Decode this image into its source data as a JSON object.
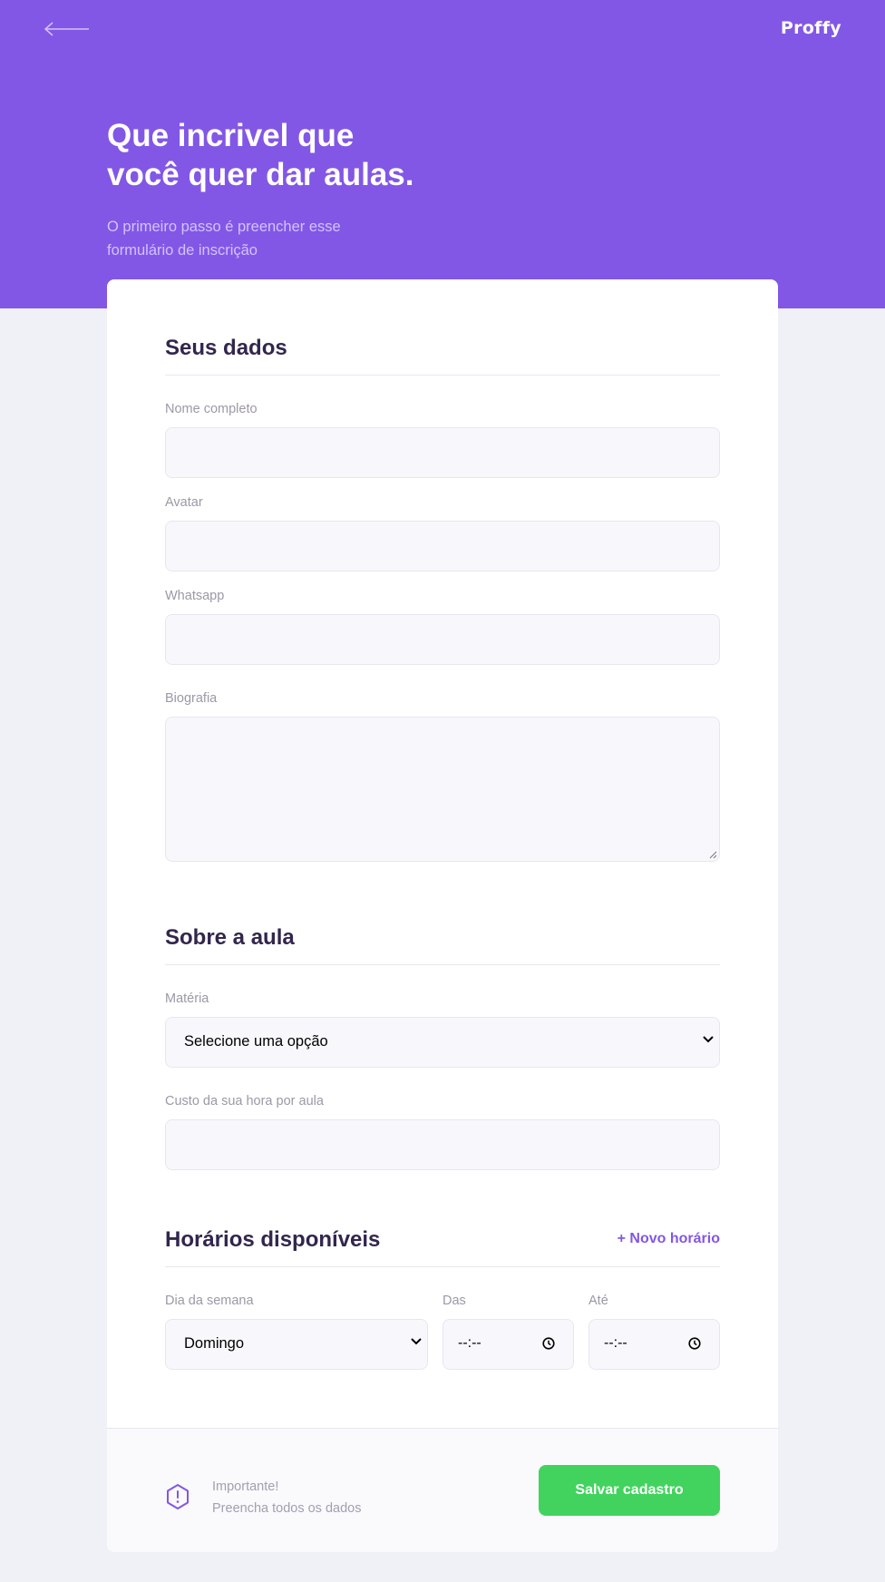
{
  "header": {
    "back_icon": "arrow-left-icon",
    "logo": "Proffy",
    "title_line1": "Que incrivel que",
    "title_line2": "você quer dar aulas.",
    "subtitle_line1": "O primeiro passo é preencher esse",
    "subtitle_line2": "formulário de inscrição"
  },
  "personal": {
    "section_title": "Seus dados",
    "name_label": "Nome completo",
    "name_value": "",
    "avatar_label": "Avatar",
    "avatar_value": "",
    "whatsapp_label": "Whatsapp",
    "whatsapp_value": "",
    "bio_label": "Biografia",
    "bio_value": ""
  },
  "class_info": {
    "section_title": "Sobre a aula",
    "subject_label": "Matéria",
    "subject_selected": "Selecione uma opção",
    "cost_label": "Custo da sua hora por aula",
    "cost_value": ""
  },
  "schedule": {
    "section_title": "Horários disponíveis",
    "new_time_label": "+ Novo horário",
    "weekday_label": "Dia da semana",
    "weekday_selected": "Domingo",
    "from_label": "Das",
    "from_value": "--:--",
    "to_label": "Até",
    "to_value": "--:--"
  },
  "footer": {
    "warning_icon": "warning-hexagon-icon",
    "warning_title": "Importante!",
    "warning_text": "Preencha todos os dados",
    "save_label": "Salvar cadastro"
  },
  "colors": {
    "primary": "#8257E5",
    "primary_light": "#D4C2FF",
    "background": "#F0F0F7",
    "title_text": "#32264D",
    "label_text": "#9C98A6",
    "input_bg": "#F8F8FC",
    "save_button": "#42D35F"
  }
}
